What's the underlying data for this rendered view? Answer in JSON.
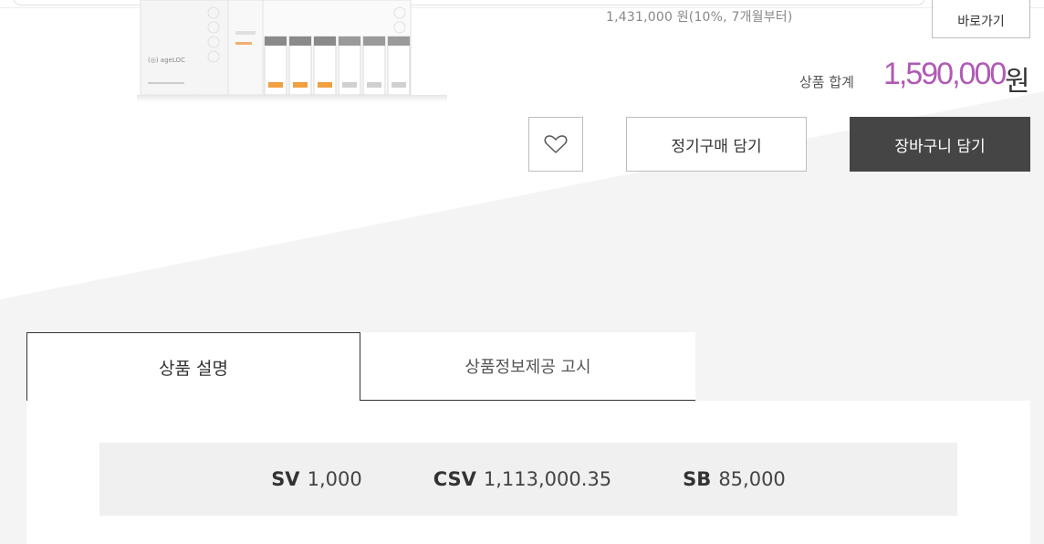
{
  "purchase": {
    "installment_text": "1,431,000 원(10%, 7개월부터)",
    "shortcut_label": "바로가기",
    "total_label": "상품 합계",
    "total_price": "1,590,000",
    "total_currency": "원"
  },
  "actions": {
    "wish_icon": "heart-icon",
    "subscribe_label": "정기구매 담기",
    "cart_label": "장바구니 담기"
  },
  "tabs": [
    {
      "label": "상품 설명",
      "active": true
    },
    {
      "label": "상품정보제공 고시",
      "active": false
    }
  ],
  "points": [
    {
      "label": "SV",
      "value": "1,000"
    },
    {
      "label": "CSV",
      "value": "1,113,000.35"
    },
    {
      "label": "SB",
      "value": "85,000"
    }
  ],
  "colors": {
    "accent_price": "#b05ab5",
    "cart_button": "#454545",
    "panel_bg": "#f0f0f0"
  },
  "product_image": {
    "brand_text": "ageLOC"
  }
}
